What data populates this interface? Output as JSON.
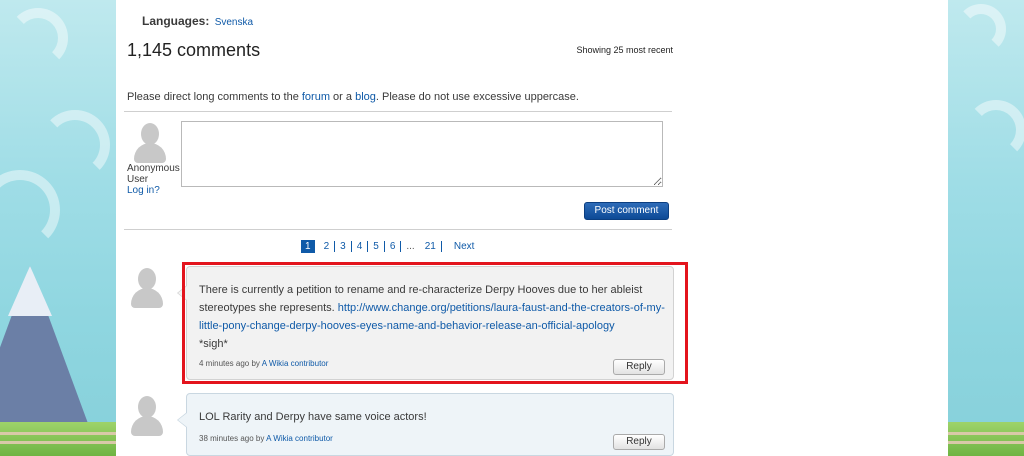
{
  "languages": {
    "label": "Languages:",
    "value": "Svenska"
  },
  "comments_header": {
    "title": "1,145 comments",
    "showing": "Showing 25 most recent"
  },
  "notice": {
    "before": "Please direct long comments to the ",
    "forum_link": "forum",
    "middle": " or a ",
    "blog_link": "blog",
    "after": ". Please do not use excessive uppercase."
  },
  "composer": {
    "user_label": "Anonymous User",
    "login_link": "Log in?",
    "textarea_value": "",
    "post_button": "Post comment"
  },
  "pagination": {
    "pages": [
      "1",
      "2",
      "3",
      "4",
      "5",
      "6"
    ],
    "ellipsis": "...",
    "last_page": "21",
    "next": "Next",
    "current": "1"
  },
  "comments": [
    {
      "text_before": "There is currently a petition to rename and re-characterize Derpy Hooves due to her ableist stereotypes she represents. ",
      "link": "http://www.change.org/petitions/laura-faust-and-the-creators-of-my-little-pony-change-derpy-hooves-eyes-name-and-behavior-release-an-official-apology",
      "text_after": "*sigh*",
      "time": "4 minutes ago by ",
      "author": "A Wikia contributor",
      "reply": "Reply"
    },
    {
      "text_before": "LOL Rarity and Derpy have same voice actors!",
      "time": "38 minutes ago by ",
      "author": "A Wikia contributor",
      "reply": "Reply"
    }
  ],
  "colors": {
    "link": "#0f5aa8",
    "primary_button": "#0d4a96",
    "highlight": "#e3141d",
    "background_sky": "#9fdde6"
  }
}
